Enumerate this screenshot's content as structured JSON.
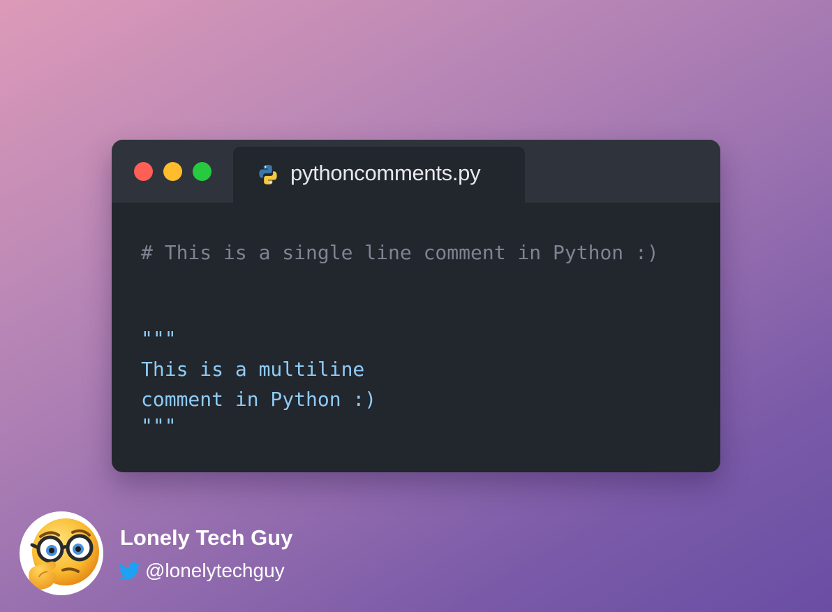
{
  "window": {
    "traffic_lights": [
      {
        "name": "close",
        "color": "#ff5f56"
      },
      {
        "name": "minimize",
        "color": "#ffbd2e"
      },
      {
        "name": "maximize",
        "color": "#27c93f"
      }
    ],
    "tab": {
      "icon": "python-icon",
      "filename": "pythoncomments.py"
    }
  },
  "code": {
    "single_line_comment": "# This is a single line comment in Python :)",
    "docstring_lines": [
      "\"\"\"",
      "This is a multiline",
      "comment in Python :)",
      "\"\"\""
    ]
  },
  "author": {
    "avatar_icon": "thinking-face-with-glasses-icon",
    "name": "Lonely Tech Guy",
    "social_icon": "twitter-icon",
    "handle": "@lonelytechguy"
  },
  "colors": {
    "comment": "#7d8591",
    "docstring": "#8ecbf5",
    "editor_bg": "#22262d",
    "titlebar_bg": "#2f343c",
    "twitter_blue": "#1da1f2"
  }
}
